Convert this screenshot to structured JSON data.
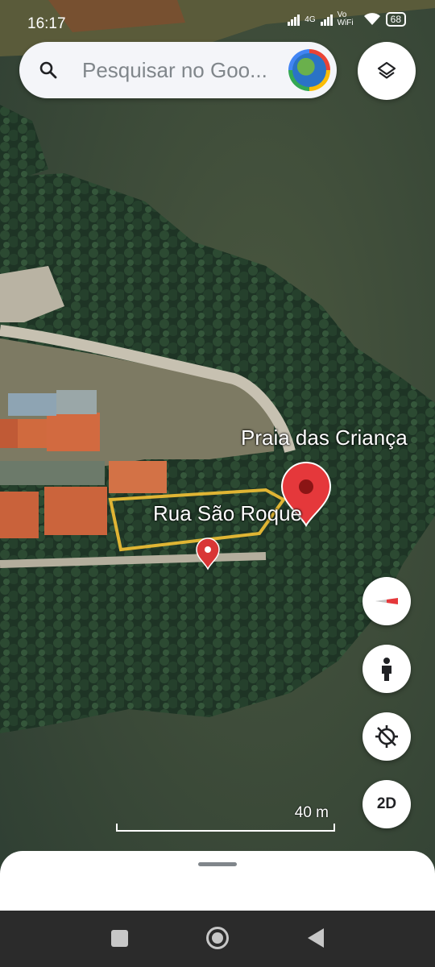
{
  "status_bar": {
    "time": "16:17",
    "network_label": "4G",
    "vowifi_label": "Vo WiFi",
    "battery": "68"
  },
  "search": {
    "placeholder": "Pesquisar no Goo..."
  },
  "icons": {
    "search": "search-icon",
    "layers": "layers-icon",
    "compass": "compass-icon",
    "street_view": "pegman-icon",
    "location": "location-off-icon",
    "place_pin": "place-pin-icon"
  },
  "map": {
    "labels": {
      "praia": "Praia das Criança",
      "rua": "Rua São Roque"
    },
    "scale": "40 m",
    "colors": {
      "water": "#3a4a3d",
      "forest": "#1f3526",
      "road": "#b8b3a5",
      "parcel_outline": "#e0b534",
      "pin": "#e5383b"
    }
  },
  "controls": {
    "toggle_2d": "2D"
  }
}
